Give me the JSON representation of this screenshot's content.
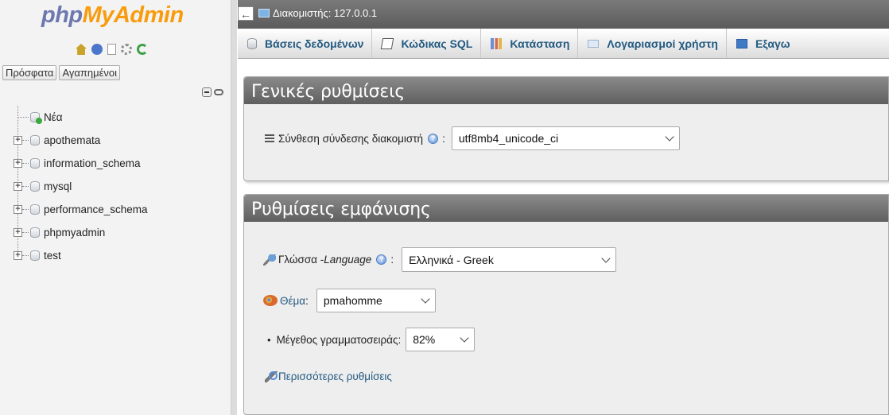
{
  "sidebar": {
    "logo": {
      "php": "php",
      "my_admin": "MyAdmin"
    },
    "quick_icons": [
      "home-icon",
      "logout-icon",
      "docs-icon",
      "settings-icon",
      "reload-icon"
    ],
    "tabs": [
      "Πρόσφατα",
      "Αγαπημένοι"
    ],
    "tree": [
      {
        "label": "Νέα",
        "new": true
      },
      {
        "label": "apothemata"
      },
      {
        "label": "information_schema"
      },
      {
        "label": "mysql"
      },
      {
        "label": "performance_schema"
      },
      {
        "label": "phpmyadmin"
      },
      {
        "label": "test"
      }
    ]
  },
  "topbar": {
    "back": "←",
    "server_title": "Διακομιστής: 127.0.0.1"
  },
  "tabs": [
    {
      "label": "Βάσεις δεδομένων",
      "icon": "database-icon"
    },
    {
      "label": "Κώδικας SQL",
      "icon": "sql-icon"
    },
    {
      "label": "Κατάσταση",
      "icon": "status-icon"
    },
    {
      "label": "Λογαριασμοί χρήστη",
      "icon": "users-icon"
    },
    {
      "label": "Εξαγω",
      "icon": "export-icon"
    }
  ],
  "general": {
    "title": "Γενικές ρυθμίσεις",
    "collation_label": "Σύνθεση σύνδεσης διακομιστή",
    "collation_colon": ":",
    "collation_value": "utf8mb4_unicode_ci"
  },
  "appearance": {
    "title": "Ρυθμίσεις εμφάνισης",
    "language_label": "Γλώσσα - ",
    "language_label_en": "Language",
    "language_colon": ":",
    "language_value": "Ελληνικά - Greek",
    "theme_label": "Θέμα",
    "theme_colon": ":",
    "theme_value": "pmahomme",
    "fontsize_bullet": "•",
    "fontsize_label": "Μέγεθος γραμματοσειράς:",
    "fontsize_value": "82%",
    "more_settings": "Περισσότερες ρυθμίσεις"
  },
  "help_glyph": "?",
  "colors": {
    "link": "#235a81",
    "logo_php": "#6c78af",
    "logo_myadmin": "#f89c0e",
    "panel_header": "#6b6b6b"
  }
}
